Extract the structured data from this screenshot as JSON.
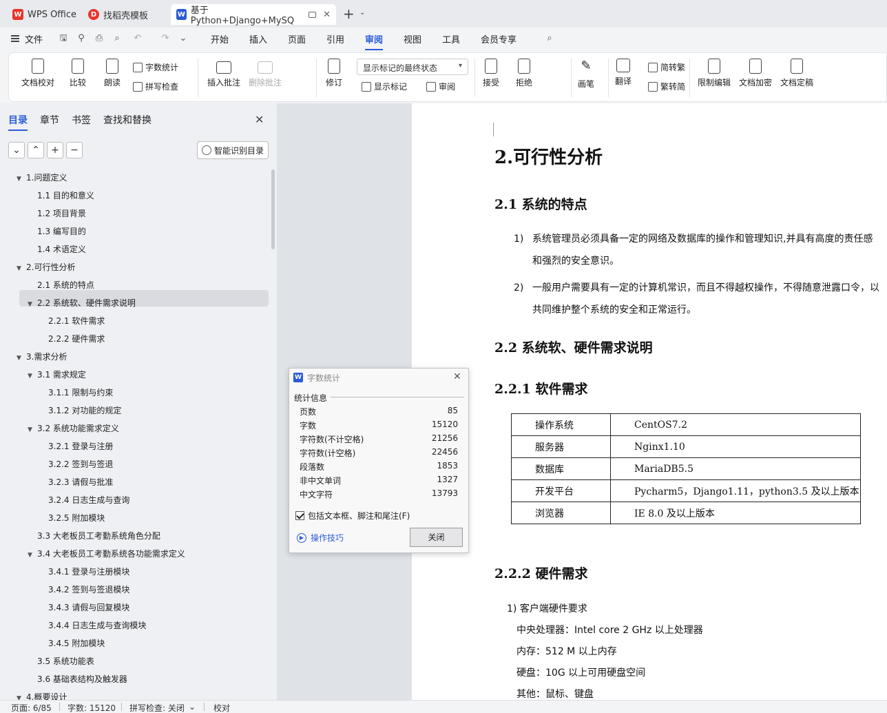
{
  "tabs": [
    {
      "label": "WPS Office",
      "icon": "wps-logo-icon",
      "color": "#e8352c"
    },
    {
      "label": "找稻壳模板",
      "icon": "docer-logo-icon",
      "color": "#e8352c"
    },
    {
      "label": "基于Python+Django+MySQ",
      "icon": "word-doc-icon",
      "color": "#2a5bd7"
    }
  ],
  "menu": {
    "file": "文件",
    "items": [
      "开始",
      "插入",
      "页面",
      "引用",
      "审阅",
      "视图",
      "工具",
      "会员专享"
    ],
    "active": "审阅"
  },
  "ribbon": {
    "doc_check": "文档校对",
    "compare": "比较",
    "read_aloud": "朗读",
    "word_count": "字数统计",
    "spell_check": "拼写检查",
    "insert_comment": "插入批注",
    "delete_comment": "删除批注",
    "track_changes": "修订",
    "markup_state": "显示标记的最终状态",
    "show_markup": "显示标记",
    "review": "审阅",
    "accept": "接受",
    "reject": "拒绝",
    "pen": "画笔",
    "translate": "翻译",
    "to_traditional": "简转繁",
    "to_simplified": "繁转简",
    "restrict_edit": "限制编辑",
    "encrypt": "文档加密",
    "finalize": "文档定稿"
  },
  "nav": {
    "tabs": [
      "目录",
      "章节",
      "书签",
      "查找和替换"
    ],
    "active_tab": "目录",
    "smart_btn": "智能识别目录",
    "selected": "1.3 编写目的",
    "toc": [
      {
        "label": "1.问题定义",
        "level": 0,
        "expand": true
      },
      {
        "label": "1.1 目的和意义",
        "level": 1,
        "expand": false
      },
      {
        "label": "1.2 项目背景",
        "level": 1,
        "expand": false
      },
      {
        "label": "1.3 编写目的",
        "level": 1,
        "expand": false
      },
      {
        "label": "1.4 术语定义",
        "level": 1,
        "expand": false
      },
      {
        "label": "2.可行性分析",
        "level": 0,
        "expand": true
      },
      {
        "label": "2.1 系统的特点",
        "level": 1,
        "expand": false
      },
      {
        "label": "2.2 系统软、硬件需求说明",
        "level": 1,
        "expand": true
      },
      {
        "label": "2.2.1 软件需求",
        "level": 2,
        "expand": false
      },
      {
        "label": "2.2.2 硬件需求",
        "level": 2,
        "expand": false
      },
      {
        "label": "3.需求分析",
        "level": 0,
        "expand": true
      },
      {
        "label": "3.1 需求规定",
        "level": 1,
        "expand": true
      },
      {
        "label": "3.1.1 限制与约束",
        "level": 2,
        "expand": false
      },
      {
        "label": "3.1.2 对功能的规定",
        "level": 2,
        "expand": false
      },
      {
        "label": "3.2 系统功能需求定义",
        "level": 1,
        "expand": true
      },
      {
        "label": "3.2.1 登录与注册",
        "level": 2,
        "expand": false
      },
      {
        "label": "3.2.2 签到与签退",
        "level": 2,
        "expand": false
      },
      {
        "label": "3.2.3 请假与批准",
        "level": 2,
        "expand": false
      },
      {
        "label": "3.2.4 日志生成与查询",
        "level": 2,
        "expand": false
      },
      {
        "label": "3.2.5 附加模块",
        "level": 2,
        "expand": false
      },
      {
        "label": "3.3 大老板员工考勤系统角色分配",
        "level": 1,
        "expand": false
      },
      {
        "label": "3.4 大老板员工考勤系统各功能需求定义",
        "level": 1,
        "expand": true
      },
      {
        "label": "3.4.1 登录与注册模块",
        "level": 2,
        "expand": false
      },
      {
        "label": "3.4.2 签到与签退模块",
        "level": 2,
        "expand": false
      },
      {
        "label": "3.4.3 请假与回复模块",
        "level": 2,
        "expand": false
      },
      {
        "label": "3.4.4 日志生成与查询模块",
        "level": 2,
        "expand": false
      },
      {
        "label": "3.4.5 附加模块",
        "level": 2,
        "expand": false
      },
      {
        "label": "3.5 系统功能表",
        "level": 1,
        "expand": false
      },
      {
        "label": "3.6 基础表结构及触发器",
        "level": 1,
        "expand": false
      },
      {
        "label": "4.概要设计",
        "level": 0,
        "expand": true
      }
    ]
  },
  "document": {
    "h1": "2.可行性分析",
    "h2_1": "2.1 系统的特点",
    "p1_num": "1)",
    "p1_line1": "系统管理员必须具备一定的网络及数据库的操作和管理知识,并具有高度的责任感",
    "p1_line2": "和强烈的安全意识。",
    "p2_num": "2)",
    "p2_line1": "一般用户需要具有一定的计算机常识，而且不得越权操作，不得随意泄露口令，以",
    "p2_line2": "共同维护整个系统的安全和正常运行。",
    "h2_2": "2.2 系统软、硬件需求说明",
    "h3_1": "2.2.1 软件需求",
    "table": [
      [
        "操作系统",
        "CentOS7.2"
      ],
      [
        "服务器",
        "Nginx1.10"
      ],
      [
        "数据库",
        "MariaDB5.5"
      ],
      [
        "开发平台",
        "Pycharm5，Django1.11，python3.5 及以上版本"
      ],
      [
        "浏览器",
        "IE 8.0 及以上版本"
      ]
    ],
    "h3_2": "2.2.2 硬件需求",
    "hw_title": "1) 客户端硬件要求",
    "hw_cpu": "中央处理器：Intel core 2 GHz 以上处理器",
    "hw_mem": "内存：512 M 以上内存",
    "hw_disk": "硬盘：10G 以上可用硬盘空间",
    "hw_other": "其他：鼠标、键盘"
  },
  "dialog": {
    "title": "字数统计",
    "section": "统计信息",
    "stats": [
      {
        "label": "页数",
        "value": "85"
      },
      {
        "label": "字数",
        "value": "15120"
      },
      {
        "label": "字符数(不计空格)",
        "value": "21256"
      },
      {
        "label": "字符数(计空格)",
        "value": "22456"
      },
      {
        "label": "段落数",
        "value": "1853"
      },
      {
        "label": "非中文单词",
        "value": "1327"
      },
      {
        "label": "中文字符",
        "value": "13793"
      }
    ],
    "checkbox": "包括文本框、脚注和尾注(F)",
    "tips": "操作技巧",
    "close": "关闭"
  },
  "status": {
    "page": "页面: 6/85",
    "words": "字数: 15120",
    "spell": "拼写检查: 关闭",
    "proof": "校对"
  }
}
